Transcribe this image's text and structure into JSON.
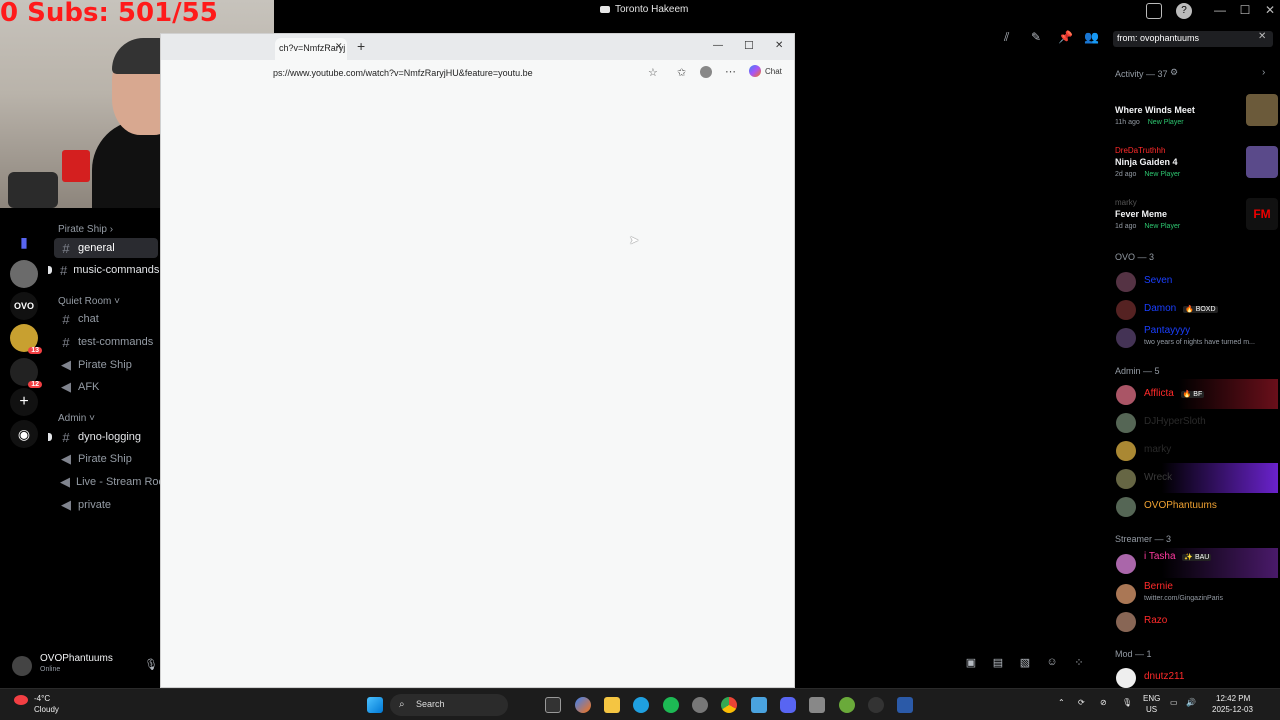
{
  "window": {
    "title": "Toronto Hakeem",
    "controls": {
      "minimize": "—",
      "maximize": "☐",
      "close": "✕"
    }
  },
  "overlay": {
    "subs_text": "0  Subs: 501/55"
  },
  "server": {
    "categories": [
      {
        "name": "Pirate Ship ›"
      },
      {
        "name": "Quiet Room ˅"
      },
      {
        "name": "Admin ˅"
      }
    ],
    "channels": {
      "general": "general",
      "music_commands": "music-commands",
      "chat": "chat",
      "test_commands": "test-commands",
      "pirate_ship_voice": "Pirate Ship",
      "afk": "AFK",
      "dyno_logging": "dyno-logging",
      "pirate_ship_voice_2": "Pirate Ship",
      "live_stream_room": "Live - Stream Roo",
      "private": "private"
    },
    "rail_badges": {
      "b1": "13",
      "b2": "12"
    }
  },
  "user": {
    "name": "OVOPhantuums",
    "status": "Online"
  },
  "browser": {
    "tab_title": "ch?v=NmfzRaryj",
    "new_tab": "+",
    "url": "ps://www.youtube.com/watch?v=NmfzRaryjHU&feature=youtu.be",
    "chat_label": "Chat",
    "controls": {
      "minimize": "—",
      "maximize": "☐",
      "close": "✕"
    }
  },
  "header": {
    "search_value": "from: ovophantuums"
  },
  "members": {
    "activity_header": "Activity — 37",
    "activities": [
      {
        "game": "Where Winds Meet",
        "time": "11h ago",
        "tag": "New Player",
        "color": "#6b5a3a"
      },
      {
        "user": "DreDaTruthhh",
        "game": "Ninja Gaiden 4",
        "time": "2d ago",
        "tag": "New Player",
        "color": "#5a4a8a"
      },
      {
        "user": "marky",
        "game": "Fever Meme",
        "time": "1d ago",
        "tag": "New Player",
        "color": "#1a1a1a"
      }
    ],
    "fever_art": "FM",
    "groups": {
      "ovo": "OVO — 3",
      "admin": "Admin — 5",
      "streamer": "Streamer — 3",
      "mod": "Mod — 1"
    },
    "ovo_members": [
      {
        "name": "Seven",
        "color": "#1a3fff",
        "sub": ""
      },
      {
        "name": "Damon",
        "color": "#1a3fff",
        "sub": "",
        "tag": "🔥 BOXD"
      },
      {
        "name": "Pantayyyy",
        "color": "#1a3fff",
        "sub": "two years of nights have turned m..."
      }
    ],
    "admin_members": [
      {
        "name": "Afflicta",
        "color": "#ff2a2a",
        "tag": "🔥 BF"
      },
      {
        "name": "DJHyperSloth",
        "color": "#2a2a2a"
      },
      {
        "name": "marky",
        "color": "#2a2a2a"
      },
      {
        "name": "Wreck",
        "color": "#3a3a3a"
      },
      {
        "name": "OVOPhantuums",
        "color": "#f0a232"
      }
    ],
    "streamer_members": [
      {
        "name": "i Tasha",
        "color": "#ff3aa0",
        "tag": "✨ BAU"
      },
      {
        "name": "Bernie",
        "color": "#ff2a2a",
        "sub": "twitter.com/GingazinParis"
      },
      {
        "name": "Razo",
        "color": "#ff2a2a"
      }
    ],
    "mod_members": [
      {
        "name": "dnutz211",
        "color": "#ff2a2a"
      }
    ]
  },
  "taskbar": {
    "weather_temp": "-4°C",
    "weather_desc": "Cloudy",
    "search_label": "Search",
    "lang_1": "ENG",
    "lang_2": "US",
    "time": "12:42 PM",
    "date": "2025-12-03"
  }
}
